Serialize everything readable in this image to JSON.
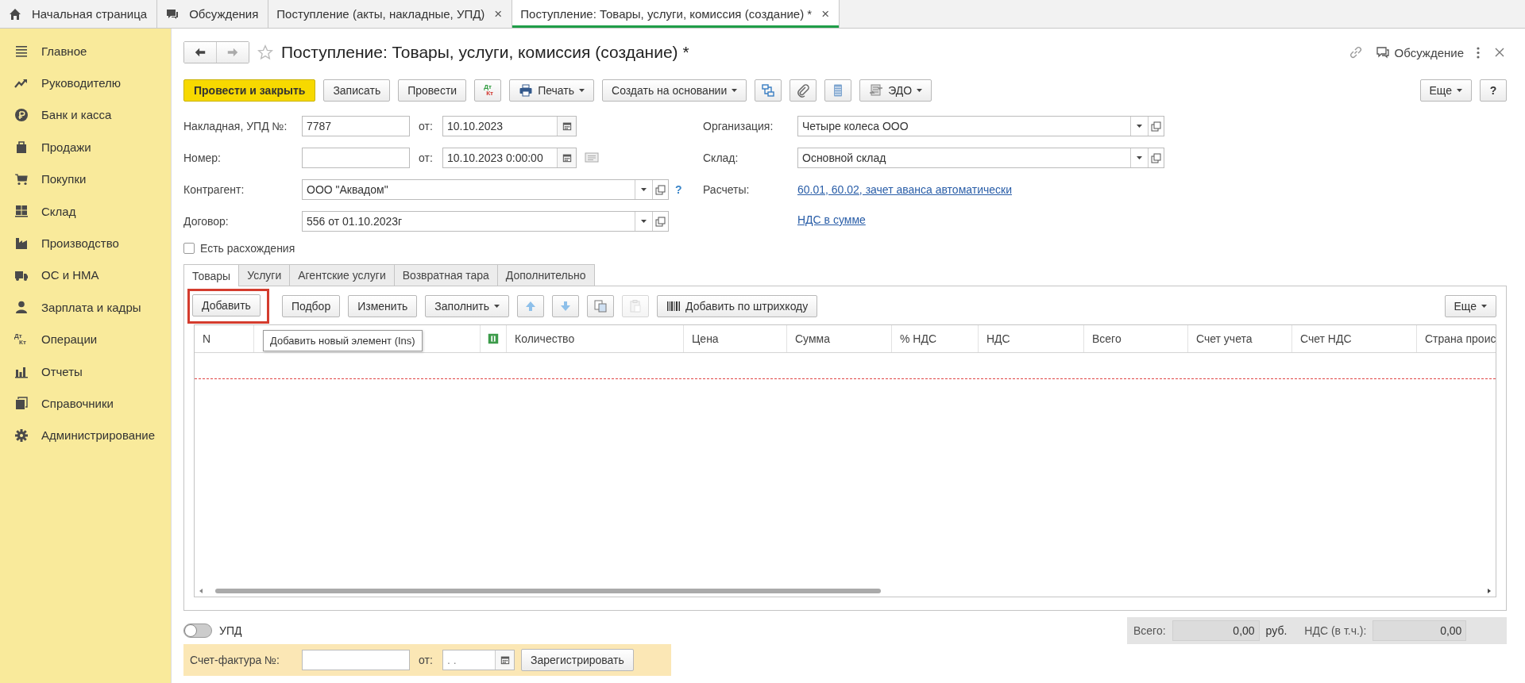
{
  "tabs": [
    {
      "label": "Начальная страница",
      "selected": false
    },
    {
      "label": "Обсуждения",
      "selected": false
    },
    {
      "label": "Поступление (акты, накладные, УПД)",
      "close": "×",
      "selected": false
    },
    {
      "label": "Поступление: Товары, услуги, комиссия (создание) *",
      "close": "×",
      "selected": true
    }
  ],
  "sidebar": {
    "items": [
      {
        "label": "Главное"
      },
      {
        "label": "Руководителю"
      },
      {
        "label": "Банк и касса"
      },
      {
        "label": "Продажи"
      },
      {
        "label": "Покупки"
      },
      {
        "label": "Склад"
      },
      {
        "label": "Производство"
      },
      {
        "label": "ОС и НМА"
      },
      {
        "label": "Зарплата и кадры"
      },
      {
        "label": "Операции",
        "icon_text": [
          "Дт",
          "Кт"
        ]
      },
      {
        "label": "Отчеты"
      },
      {
        "label": "Справочники"
      },
      {
        "label": "Администрирование"
      }
    ]
  },
  "form": {
    "title": "Поступление: Товары, услуги, комиссия (создание) *",
    "favorite": false,
    "discussion": "Обсуждение"
  },
  "toolbar": {
    "left": [
      {
        "kind": "primary",
        "label": "Провести и закрыть"
      },
      {
        "kind": "button",
        "label": "Записать"
      },
      {
        "kind": "button",
        "label": "Провести"
      },
      {
        "kind": "dtkt",
        "icon_text": [
          "Дт",
          "Кт"
        ]
      },
      {
        "kind": "dropdown",
        "label": "Печать"
      },
      {
        "kind": "dropdown",
        "label": "Создать на основании"
      },
      {
        "kind": "icon"
      },
      {
        "kind": "icon"
      },
      {
        "kind": "icon"
      },
      {
        "kind": "dropdown",
        "label": "ЭДО"
      }
    ],
    "right": [
      {
        "kind": "dropdown",
        "label": "Еще"
      },
      {
        "kind": "help",
        "label": "?"
      }
    ]
  },
  "left_fields": [
    {
      "kind": "text_date",
      "label": "Накладная, УПД №:",
      "value": "7787",
      "date_label": "от:",
      "date": "10.10.2023"
    },
    {
      "kind": "text_date",
      "label": "Номер:",
      "date_label": "от:",
      "date": "10.10.2023  0:00:00",
      "note_icon": true
    },
    {
      "kind": "select",
      "label": "Контрагент:",
      "value": "ООО \"Аквадом\"",
      "help": "?"
    },
    {
      "kind": "select",
      "label": "Договор:",
      "value": "556 от 01.10.2023г"
    }
  ],
  "right_fields": [
    {
      "kind": "select",
      "label": "Организация:",
      "value": "Четыре колеса ООО"
    },
    {
      "kind": "select",
      "label": "Склад:",
      "value": "Основной склад"
    },
    {
      "kind": "link",
      "label": "Расчеты:",
      "value": "60.01, 60.02, зачет аванса автоматически"
    },
    {
      "kind": "link",
      "value": "НДС в сумме"
    }
  ],
  "discrepancy": {
    "label": "Есть расхождения",
    "checked": false
  },
  "subtabs": [
    {
      "label": "Товары",
      "selected": true
    },
    {
      "label": "Услуги",
      "selected": false
    },
    {
      "label": "Агентские услуги",
      "selected": false
    },
    {
      "label": "Возвратная тара",
      "selected": false
    },
    {
      "label": "Дополнительно",
      "selected": false
    }
  ],
  "table_toolbar": {
    "left": [
      {
        "kind": "button",
        "label": "Добавить",
        "highlighted": true
      },
      {
        "kind": "button",
        "label": "Подбор",
        "highlighted": false
      },
      {
        "kind": "button",
        "label": "Изменить",
        "highlighted": false
      },
      {
        "kind": "dropdown",
        "label": "Заполнить"
      },
      {
        "kind": "icon",
        "disabled": false
      },
      {
        "kind": "icon",
        "disabled": false
      },
      {
        "kind": "icon",
        "disabled": false
      },
      {
        "kind": "icon",
        "disabled": true
      },
      {
        "kind": "button",
        "label": "Добавить по штрихкоду",
        "highlighted": false
      }
    ],
    "right": [
      {
        "kind": "dropdown",
        "label": "Еще"
      }
    ]
  },
  "table": {
    "columns": [
      {
        "label": "N"
      },
      {
        "kind": "covered"
      },
      {
        "kind": "icon"
      },
      {
        "label": "Количество"
      },
      {
        "label": "Цена"
      },
      {
        "label": "Сумма"
      },
      {
        "label": "% НДС"
      },
      {
        "label": "НДС"
      },
      {
        "label": "Всего"
      },
      {
        "label": "Счет учета"
      },
      {
        "label": "Счет НДС"
      },
      {
        "label": "Страна проис"
      }
    ],
    "tooltip": "Добавить новый элемент (Ins)"
  },
  "upd_toggle": {
    "label": "УПД",
    "on": false
  },
  "totals": [
    {
      "label": "Всего:",
      "value": "0,00",
      "unit": "руб."
    },
    {
      "label": "НДС (в т.ч.):",
      "value": "0,00"
    }
  ],
  "invoice": {
    "label": "Счет-фактура №:",
    "date_label": "от:",
    "date_mask": ".  .",
    "button": "Зарегистрировать"
  }
}
